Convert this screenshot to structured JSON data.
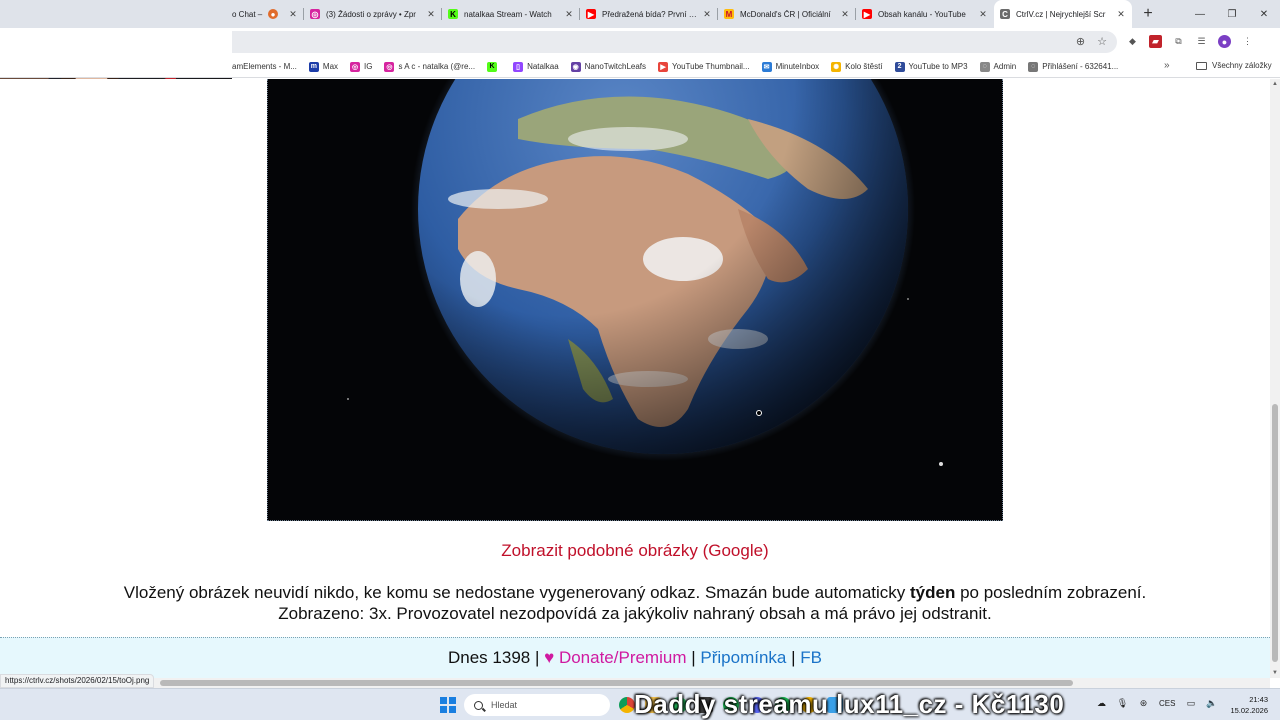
{
  "browser": {
    "tabs": [
      {
        "label": "o Chat –",
        "color": "#e06b2b",
        "icon": "chat-icon",
        "active": false
      },
      {
        "label": "(3) Žádosti o zprávy • Zpr",
        "color": "#d6249f",
        "icon": "instagram-icon",
        "active": false
      },
      {
        "label": "natalkaa Stream - Watch",
        "color": "#53fc18",
        "icon": "kick-icon",
        "active": false
      },
      {
        "label": "Předražená bída? První FF",
        "color": "#ff0000",
        "icon": "youtube-icon",
        "active": false
      },
      {
        "label": "McDonald's ČR | Oficiální",
        "color": "#ffbc0d",
        "icon": "mcdonalds-icon",
        "active": false
      },
      {
        "label": "Obsah kanálu - YouTube",
        "color": "#ff0000",
        "icon": "youtube-icon",
        "active": false
      },
      {
        "label": "CtrlV.cz | Nejrychlejší Scr",
        "color": "#6b6b6b",
        "icon": "ctrlv-icon",
        "active": true
      }
    ],
    "bookmarks": [
      {
        "label": "amElements - M...",
        "color": "#3b5998",
        "icon": "streamelements-icon"
      },
      {
        "label": "Max",
        "color": "#1c3ca8",
        "icon": "max-icon"
      },
      {
        "label": "IG",
        "color": "#d6249f",
        "icon": "instagram-icon"
      },
      {
        "label": "s A c - natalka (@re...",
        "color": "#d6249f",
        "icon": "instagram-icon"
      },
      {
        "label": "",
        "color": "#53fc18",
        "icon": "kick-icon"
      },
      {
        "label": "Natalkaa",
        "color": "#9146ff",
        "icon": "twitch-icon"
      },
      {
        "label": "NanoTwitchLeafs",
        "color": "#6441a5",
        "icon": "nano-icon"
      },
      {
        "label": "YouTube Thumbnail...",
        "color": "#e8453c",
        "icon": "youtube-thumbnail-icon"
      },
      {
        "label": "MinuteInbox",
        "color": "#2b7bd6",
        "icon": "mail-icon"
      },
      {
        "label": "Kolo štěstí",
        "color": "#f4b400",
        "icon": "wheel-icon"
      },
      {
        "label": "YouTube to MP3",
        "color": "#2f4b9a",
        "icon": "converter-icon"
      },
      {
        "label": "Admin",
        "color": "#888888",
        "icon": "globe-icon"
      },
      {
        "label": "Přihlášení - 632641...",
        "color": "#777777",
        "icon": "login-icon"
      }
    ],
    "bookmarks_all_label": "Všechny záložky",
    "status_url": "https://ctrlv.cz/shots/2026/02/15/toOj.png"
  },
  "page": {
    "similar_link": "Zobrazit podobné obrázky (Google)",
    "notice_line1_a": "Vložený obrázek neuvidí nikdo, ke komu se nedostane vygenerovaný odkaz. Smazán bude automaticky ",
    "notice_line1_bold": "týden",
    "notice_line1_b": " po posledním zobrazení.",
    "notice_line2": "Zobrazeno: 3x. Provozovatel nezodpovídá za jakýkoliv nahraný obsah a má právo jej odstranit.",
    "footer": {
      "today": "Dnes 1398 |",
      "heart": "♥",
      "donate": "Donate/Premium",
      "sep1": "|",
      "reminder": "Připomínka",
      "sep2": "|",
      "fb": "FB"
    }
  },
  "taskbar": {
    "search_placeholder": "Hledat",
    "overlay": "Daddy streamu lux11_cz - Kč1130",
    "language": "CES",
    "time": "21:43",
    "date": "15.02.2026"
  }
}
